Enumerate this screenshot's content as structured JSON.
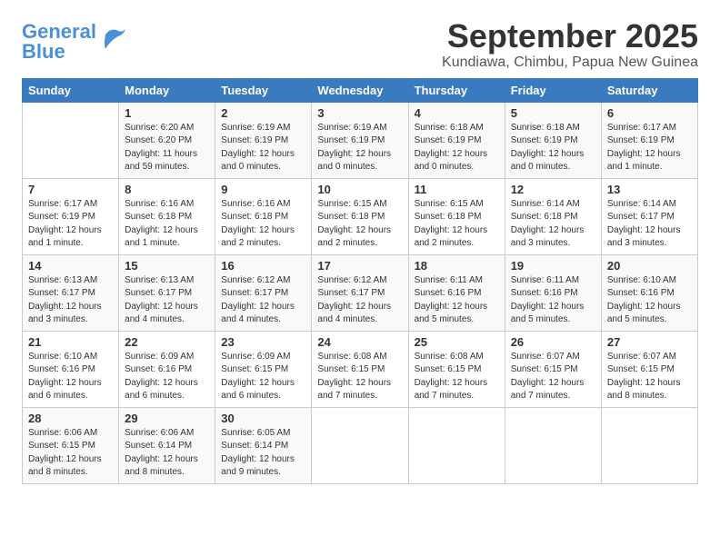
{
  "header": {
    "logo_general": "General",
    "logo_blue": "Blue",
    "month_title": "September 2025",
    "subtitle": "Kundiawa, Chimbu, Papua New Guinea"
  },
  "columns": [
    "Sunday",
    "Monday",
    "Tuesday",
    "Wednesday",
    "Thursday",
    "Friday",
    "Saturday"
  ],
  "weeks": [
    [
      {
        "day": "",
        "info": ""
      },
      {
        "day": "1",
        "info": "Sunrise: 6:20 AM\nSunset: 6:20 PM\nDaylight: 11 hours\nand 59 minutes."
      },
      {
        "day": "2",
        "info": "Sunrise: 6:19 AM\nSunset: 6:19 PM\nDaylight: 12 hours\nand 0 minutes."
      },
      {
        "day": "3",
        "info": "Sunrise: 6:19 AM\nSunset: 6:19 PM\nDaylight: 12 hours\nand 0 minutes."
      },
      {
        "day": "4",
        "info": "Sunrise: 6:18 AM\nSunset: 6:19 PM\nDaylight: 12 hours\nand 0 minutes."
      },
      {
        "day": "5",
        "info": "Sunrise: 6:18 AM\nSunset: 6:19 PM\nDaylight: 12 hours\nand 0 minutes."
      },
      {
        "day": "6",
        "info": "Sunrise: 6:17 AM\nSunset: 6:19 PM\nDaylight: 12 hours\nand 1 minute."
      }
    ],
    [
      {
        "day": "7",
        "info": "Sunrise: 6:17 AM\nSunset: 6:19 PM\nDaylight: 12 hours\nand 1 minute."
      },
      {
        "day": "8",
        "info": "Sunrise: 6:16 AM\nSunset: 6:18 PM\nDaylight: 12 hours\nand 1 minute."
      },
      {
        "day": "9",
        "info": "Sunrise: 6:16 AM\nSunset: 6:18 PM\nDaylight: 12 hours\nand 2 minutes."
      },
      {
        "day": "10",
        "info": "Sunrise: 6:15 AM\nSunset: 6:18 PM\nDaylight: 12 hours\nand 2 minutes."
      },
      {
        "day": "11",
        "info": "Sunrise: 6:15 AM\nSunset: 6:18 PM\nDaylight: 12 hours\nand 2 minutes."
      },
      {
        "day": "12",
        "info": "Sunrise: 6:14 AM\nSunset: 6:18 PM\nDaylight: 12 hours\nand 3 minutes."
      },
      {
        "day": "13",
        "info": "Sunrise: 6:14 AM\nSunset: 6:17 PM\nDaylight: 12 hours\nand 3 minutes."
      }
    ],
    [
      {
        "day": "14",
        "info": "Sunrise: 6:13 AM\nSunset: 6:17 PM\nDaylight: 12 hours\nand 3 minutes."
      },
      {
        "day": "15",
        "info": "Sunrise: 6:13 AM\nSunset: 6:17 PM\nDaylight: 12 hours\nand 4 minutes."
      },
      {
        "day": "16",
        "info": "Sunrise: 6:12 AM\nSunset: 6:17 PM\nDaylight: 12 hours\nand 4 minutes."
      },
      {
        "day": "17",
        "info": "Sunrise: 6:12 AM\nSunset: 6:17 PM\nDaylight: 12 hours\nand 4 minutes."
      },
      {
        "day": "18",
        "info": "Sunrise: 6:11 AM\nSunset: 6:16 PM\nDaylight: 12 hours\nand 5 minutes."
      },
      {
        "day": "19",
        "info": "Sunrise: 6:11 AM\nSunset: 6:16 PM\nDaylight: 12 hours\nand 5 minutes."
      },
      {
        "day": "20",
        "info": "Sunrise: 6:10 AM\nSunset: 6:16 PM\nDaylight: 12 hours\nand 5 minutes."
      }
    ],
    [
      {
        "day": "21",
        "info": "Sunrise: 6:10 AM\nSunset: 6:16 PM\nDaylight: 12 hours\nand 6 minutes."
      },
      {
        "day": "22",
        "info": "Sunrise: 6:09 AM\nSunset: 6:16 PM\nDaylight: 12 hours\nand 6 minutes."
      },
      {
        "day": "23",
        "info": "Sunrise: 6:09 AM\nSunset: 6:15 PM\nDaylight: 12 hours\nand 6 minutes."
      },
      {
        "day": "24",
        "info": "Sunrise: 6:08 AM\nSunset: 6:15 PM\nDaylight: 12 hours\nand 7 minutes."
      },
      {
        "day": "25",
        "info": "Sunrise: 6:08 AM\nSunset: 6:15 PM\nDaylight: 12 hours\nand 7 minutes."
      },
      {
        "day": "26",
        "info": "Sunrise: 6:07 AM\nSunset: 6:15 PM\nDaylight: 12 hours\nand 7 minutes."
      },
      {
        "day": "27",
        "info": "Sunrise: 6:07 AM\nSunset: 6:15 PM\nDaylight: 12 hours\nand 8 minutes."
      }
    ],
    [
      {
        "day": "28",
        "info": "Sunrise: 6:06 AM\nSunset: 6:15 PM\nDaylight: 12 hours\nand 8 minutes."
      },
      {
        "day": "29",
        "info": "Sunrise: 6:06 AM\nSunset: 6:14 PM\nDaylight: 12 hours\nand 8 minutes."
      },
      {
        "day": "30",
        "info": "Sunrise: 6:05 AM\nSunset: 6:14 PM\nDaylight: 12 hours\nand 9 minutes."
      },
      {
        "day": "",
        "info": ""
      },
      {
        "day": "",
        "info": ""
      },
      {
        "day": "",
        "info": ""
      },
      {
        "day": "",
        "info": ""
      }
    ]
  ]
}
